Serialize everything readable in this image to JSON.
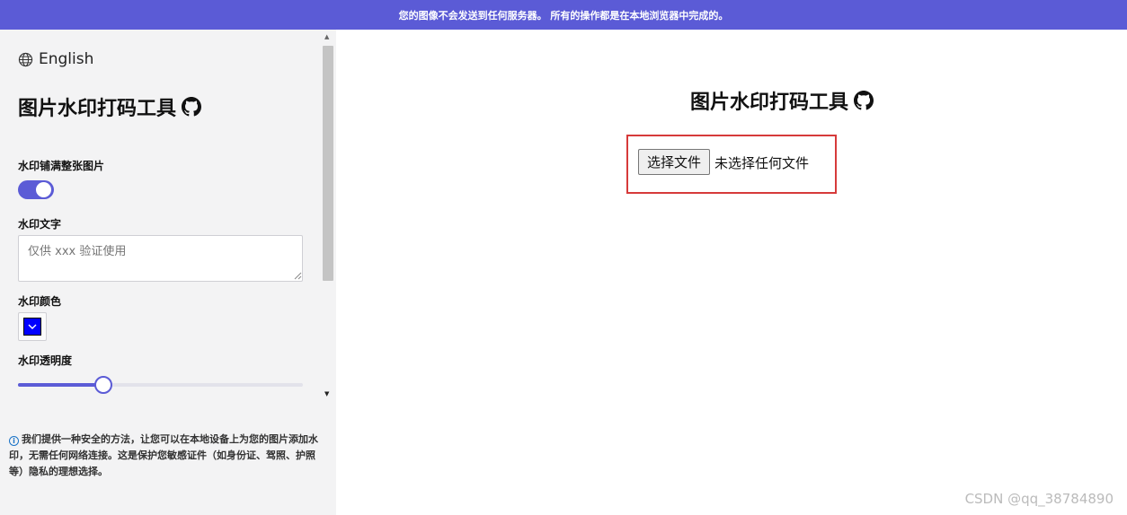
{
  "banner": {
    "text": "您的图像不会发送到任何服务器。 所有的操作都是在本地浏览器中完成的。"
  },
  "sidebar": {
    "language": {
      "label": "English",
      "icon": "globe-icon"
    },
    "title": "图片水印打码工具",
    "fields": {
      "fill_label": "水印铺满整张图片",
      "fill_enabled": true,
      "text_label": "水印文字",
      "text_placeholder": "仅供 xxx 验证使用",
      "color_label": "水印颜色",
      "color_value": "#0000ff",
      "opacity_label": "水印透明度",
      "opacity_fraction": 0.3
    },
    "info_text": "我们提供一种安全的方法，让您可以在本地设备上为您的图片添加水印，无需任何网络连接。这是保护您敏感证件（如身份证、驾照、护照等）隐私的理想选择。"
  },
  "main": {
    "title": "图片水印打码工具",
    "file_button": "选择文件",
    "file_status": "未选择任何文件"
  },
  "footer": {
    "watermark": "CSDN @qq_38784890"
  },
  "colors": {
    "accent": "#5b5bd6",
    "highlight": "#d63a3a"
  }
}
